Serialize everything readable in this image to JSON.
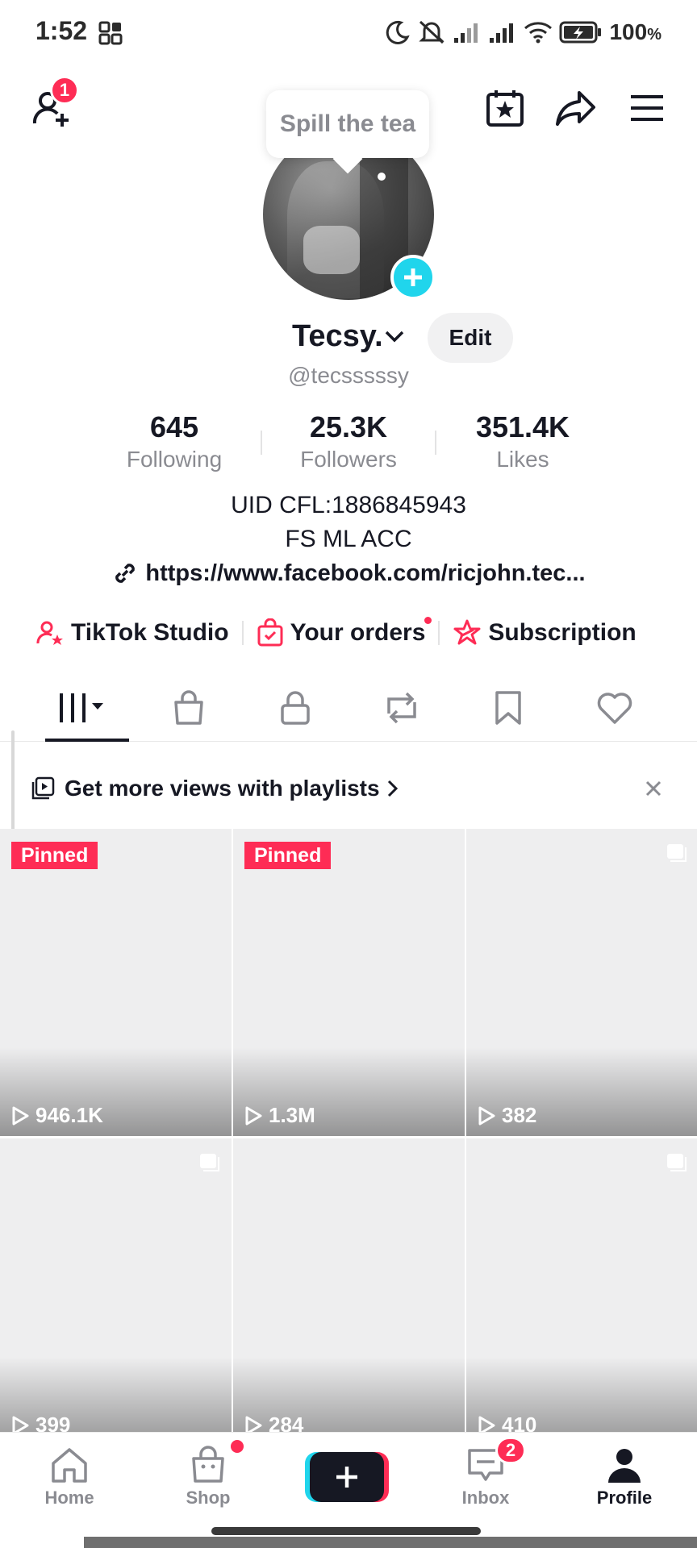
{
  "status_bar": {
    "time": "1:52",
    "battery_percent": "100",
    "battery_unit": "%"
  },
  "header": {
    "friend_requests_badge": "1",
    "tooltip": "Spill the tea"
  },
  "profile": {
    "display_name": "Tecsy.",
    "edit_label": "Edit",
    "username": "@tecsssssy",
    "stats": [
      {
        "value": "645",
        "label": "Following"
      },
      {
        "value": "25.3K",
        "label": "Followers"
      },
      {
        "value": "351.4K",
        "label": "Likes"
      }
    ],
    "bio_lines": [
      "UID CFL:1886845943",
      "FS ML ACC"
    ],
    "link": "https://www.facebook.com/ricjohn.tec..."
  },
  "quick_links": [
    {
      "label": "TikTok Studio",
      "icon": "person-star-icon"
    },
    {
      "label": "Your orders",
      "icon": "shopping-bag-check-icon"
    },
    {
      "label": "Subscription",
      "icon": "subscription-star-icon"
    }
  ],
  "tabs": [
    {
      "name": "videos",
      "icon": "grid-columns-icon",
      "active": true
    },
    {
      "name": "shop",
      "icon": "bag-icon"
    },
    {
      "name": "private",
      "icon": "lock-icon"
    },
    {
      "name": "reposts",
      "icon": "repost-icon"
    },
    {
      "name": "favorites",
      "icon": "bookmark-icon"
    },
    {
      "name": "liked",
      "icon": "heart-icon"
    }
  ],
  "playlist_banner": {
    "text": "Get more views with playlists"
  },
  "videos": [
    {
      "pinned": "Pinned",
      "views": "946.1K"
    },
    {
      "pinned": "Pinned",
      "views": "1.3M"
    },
    {
      "pinned": "",
      "views": "382"
    },
    {
      "pinned": "",
      "views": "399"
    },
    {
      "pinned": "",
      "views": "284"
    },
    {
      "pinned": "",
      "views": "410"
    }
  ],
  "bottom_nav": {
    "home": "Home",
    "shop": "Shop",
    "inbox": "Inbox",
    "inbox_badge": "2",
    "profile": "Profile"
  },
  "colors": {
    "accent_red": "#fe2c55",
    "accent_cyan": "#20d5ec",
    "text_primary": "#161823",
    "text_secondary": "#8a8b91"
  }
}
